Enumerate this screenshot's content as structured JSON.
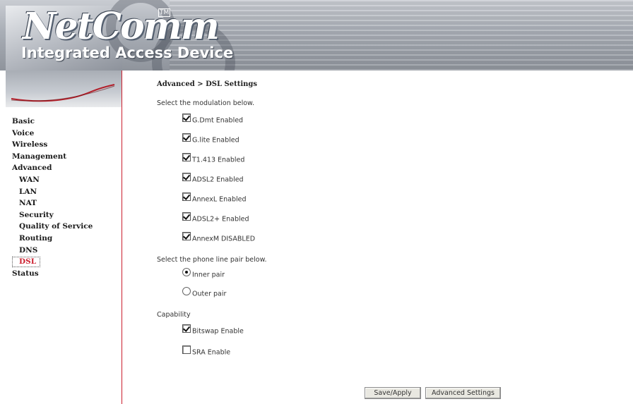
{
  "header": {
    "logo_text": "NetComm",
    "tm": "TM",
    "subtitle": "Integrated Access Device"
  },
  "sidebar": {
    "items": [
      {
        "label": "Basic",
        "level": 0,
        "active": false
      },
      {
        "label": "Voice",
        "level": 0,
        "active": false
      },
      {
        "label": "Wireless",
        "level": 0,
        "active": false
      },
      {
        "label": "Management",
        "level": 0,
        "active": false
      },
      {
        "label": "Advanced",
        "level": 0,
        "active": false
      },
      {
        "label": "WAN",
        "level": 1,
        "active": false
      },
      {
        "label": "LAN",
        "level": 1,
        "active": false
      },
      {
        "label": "NAT",
        "level": 1,
        "active": false
      },
      {
        "label": "Security",
        "level": 1,
        "active": false
      },
      {
        "label": "Quality of Service",
        "level": 1,
        "active": false
      },
      {
        "label": "Routing",
        "level": 1,
        "active": false
      },
      {
        "label": "DNS",
        "level": 1,
        "active": false
      },
      {
        "label": "DSL",
        "level": 1,
        "active": true
      },
      {
        "label": "Status",
        "level": 0,
        "active": false
      }
    ]
  },
  "main": {
    "breadcrumb": "Advanced > DSL Settings",
    "modulation_prompt": "Select the modulation below.",
    "modulations": [
      {
        "label": "G.Dmt Enabled",
        "checked": true
      },
      {
        "label": "G.lite Enabled",
        "checked": true
      },
      {
        "label": "T1.413 Enabled",
        "checked": true
      },
      {
        "label": "ADSL2 Enabled",
        "checked": true
      },
      {
        "label": "AnnexL Enabled",
        "checked": true
      },
      {
        "label": "ADSL2+ Enabled",
        "checked": true
      },
      {
        "label": "AnnexM DISABLED",
        "checked": true
      }
    ],
    "phone_pair_prompt": "Select the phone line pair below.",
    "phone_pairs": [
      {
        "label": "Inner pair",
        "selected": true
      },
      {
        "label": "Outer pair",
        "selected": false
      }
    ],
    "capability_title": "Capability",
    "capabilities": [
      {
        "label": "Bitswap Enable",
        "checked": true
      },
      {
        "label": "SRA Enable",
        "checked": false
      }
    ],
    "buttons": {
      "save_apply": "Save/Apply",
      "advanced_settings": "Advanced Settings"
    }
  },
  "colors": {
    "accent_red": "#cc1f2e",
    "button_bg": "#e9e8e1"
  }
}
